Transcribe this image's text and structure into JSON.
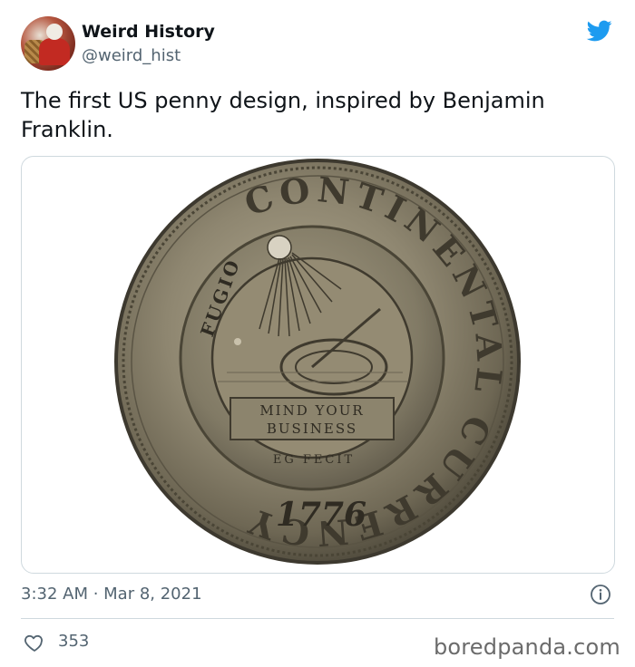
{
  "author": {
    "display_name": "Weird History",
    "handle": "@weird_hist",
    "avatar_icon": "avatar-photo"
  },
  "platform_icon": "twitter-bird-icon",
  "tweet": {
    "text": "The first US penny design, inspired by Benjamin Franklin.",
    "timestamp": "3:32 AM · Mar 8, 2021",
    "likes": "353"
  },
  "media": {
    "coin_ring_text": "CONTINENTAL CURRENCY",
    "coin_year": "1776",
    "coin_inner_top": "FUGIO",
    "coin_motto_line1": "MIND YOUR",
    "coin_motto_line2": "BUSINESS",
    "coin_maker": "EG FECIT"
  },
  "watermark": "boredpanda.com",
  "colors": {
    "twitter_blue": "#1d9bf0",
    "secondary_text": "#536471",
    "border": "#cfd9de"
  }
}
